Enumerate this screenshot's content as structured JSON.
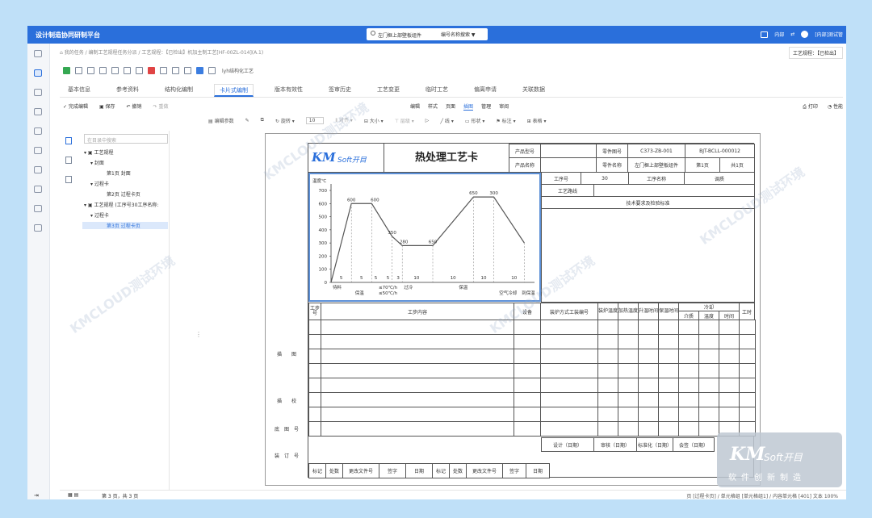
{
  "app": {
    "title": "设计制造协同研制平台"
  },
  "search": {
    "value": "左门框上部壁板组件",
    "mode": "编号名称搜索"
  },
  "topRight": {
    "internal": "内部",
    "user": "[内部]测试管"
  },
  "breadcrumb": {
    "home": "首页",
    "text": "我的任务  /  编制工艺规程任务分派  /  工艺规程：【已检出】机加主制工艺[HF-00ZL-014](A.1)",
    "right": "工艺规程：【已检出】"
  },
  "toolbar1": {
    "lyh": "lyh结构化工艺"
  },
  "tabs": [
    "基本信息",
    "参考资料",
    "结构化编制",
    "卡片式编制",
    "版本有效性",
    "签审历史",
    "工艺变更",
    "临时工艺",
    "偏离申请",
    "关联数据"
  ],
  "activeTab": 3,
  "edit": {
    "done": "完成编辑",
    "save": "保存",
    "undo": "撤销",
    "redo": "重做"
  },
  "menus": [
    "编辑",
    "样式",
    "页面",
    "插图",
    "管理",
    "审阅"
  ],
  "activeMenu": 3,
  "menuRight": {
    "print": "打印",
    "perf": "性能"
  },
  "fmt": {
    "param": "编辑参数",
    "rotate": "旋转",
    "size_value": "10",
    "align": "对齐",
    "sizeL": "大小",
    "layer": "层级",
    "line": "线",
    "shape": "形状",
    "mark": "标注",
    "table": "表格"
  },
  "tree": {
    "search_placeholder": "在目录中搜索",
    "nodes": [
      "工艺规程",
      "封面",
      "第1页 封面",
      "过程卡",
      "第2页 过程卡页",
      "工艺规程 (工序号30工序名称:",
      "过程卡",
      "第3页 过程卡页"
    ]
  },
  "card": {
    "logo_km": "KM",
    "logo_soft": "Soft开目",
    "title": "热处理工艺卡",
    "product_type_label": "产品型号",
    "product_name_label": "产品名称",
    "part_no_label": "零件图号",
    "part_no": "C373-ZB-001",
    "part_code": "BJT-BCLL-000012",
    "part_name_label": "零件名称",
    "part_name": "左门框上部壁板组件",
    "page_total": "共1页",
    "page_no": "第1页",
    "op_no_label": "工序号",
    "op_no": "30",
    "op_name_label": "工序名称",
    "op_name": "调质",
    "route_label": "工艺路线",
    "tech_req": "技术要求及检验标准",
    "col_step": "工步号",
    "col_content": "工步内容",
    "col_equip": "设备",
    "col_fixture": "装炉方式工装编号",
    "col_load_temp": "装炉温度",
    "col_heat_temp": "加热温度",
    "col_rise_time": "升温时间",
    "col_hold_time": "保温时间",
    "col_cool": "冷却",
    "col_medium": "介质",
    "col_temp": "温度",
    "col_time": "时间",
    "col_hours": "工时",
    "side_labels": [
      "描　　图",
      "描　　校",
      "底　图　号",
      "装　订　号"
    ],
    "sign_row": [
      "设计（日期）",
      "审核（日期）",
      "标准化（日期）",
      "会签（日期）"
    ],
    "footer": [
      "标记",
      "处数",
      "更改文件号",
      "签字",
      "日期",
      "标记",
      "处数",
      "更改文件号",
      "签字",
      "日期"
    ]
  },
  "chart_data": {
    "type": "line",
    "ylabel": "温度℃",
    "yticks": [
      0,
      100,
      200,
      300,
      400,
      500,
      600,
      700
    ],
    "ylim": [
      0,
      700
    ],
    "points": [
      [
        0,
        0
      ],
      [
        10,
        600
      ],
      [
        20,
        600
      ],
      [
        30,
        350
      ],
      [
        35,
        280
      ],
      [
        50,
        280
      ],
      [
        70,
        650
      ],
      [
        80,
        650
      ],
      [
        95,
        300
      ]
    ],
    "point_labels": [
      "600",
      "600",
      "350",
      "280",
      "650",
      "650",
      "300"
    ],
    "segment_values": [
      "5",
      "5",
      "5",
      "5",
      "3",
      "10",
      "10",
      "10",
      "10"
    ],
    "phase_labels": [
      "待料",
      "保温",
      "≤70℃/h",
      "≤50℃/h",
      "过冷",
      "保温",
      "空气冷却",
      "到保温"
    ]
  },
  "status": {
    "left": "第 3 页，共 3 页",
    "right": "页 [过程卡页] / 单元格组 [单元格组1] / 内容单元格 [401]   文本   100%"
  },
  "watermark": "KMCLOUD测试环境",
  "logoCard": {
    "km": "KM",
    "soft": "Soft开目",
    "sub": "软件创新制造"
  }
}
